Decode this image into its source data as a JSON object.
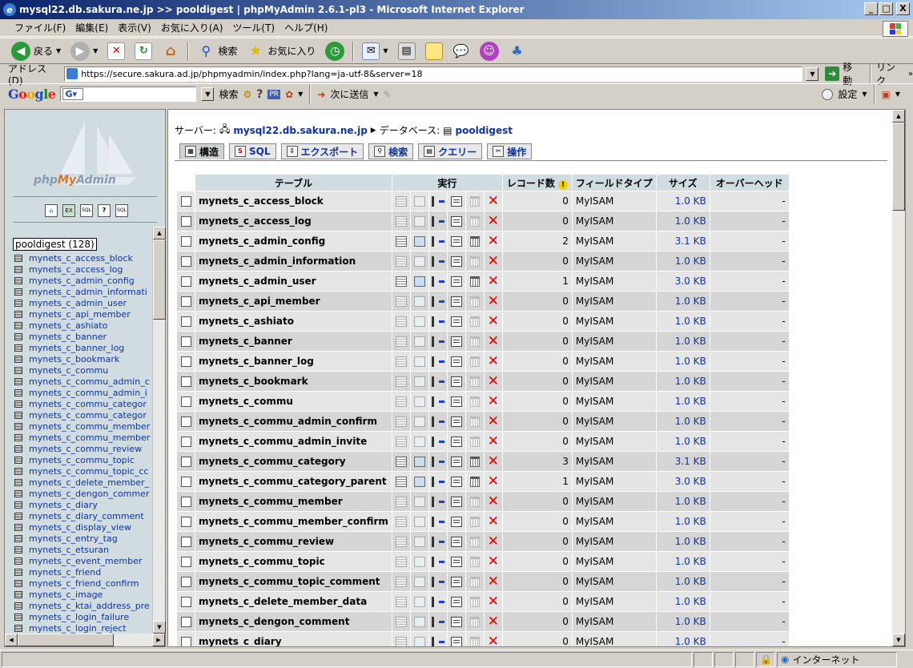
{
  "window": {
    "title": "mysql22.db.sakura.ne.jp >> pooldigest | phpMyAdmin 2.6.1-pl3 - Microsoft Internet Explorer",
    "btn_min": "_",
    "btn_max": "□",
    "btn_close": "X"
  },
  "menu": [
    "ファイル(F)",
    "編集(E)",
    "表示(V)",
    "お気に入り(A)",
    "ツール(T)",
    "ヘルプ(H)"
  ],
  "toolbar": {
    "back": "戻る",
    "search": "検索",
    "favorites": "お気に入り"
  },
  "address": {
    "label": "アドレス(D)",
    "url": "https://secure.sakura.ad.jp/phpmyadmin/index.php?lang=ja-utf-8&server=18",
    "go": "移動",
    "links": "リンク"
  },
  "google_bar": {
    "search": "検索",
    "send": "次に送信",
    "settings": "設定"
  },
  "left": {
    "logo_php": "php",
    "logo_my": "My",
    "logo_admin": "Admin",
    "db_name": "pooldigest",
    "db_count": "(128)",
    "tables": [
      "mynets_c_access_block",
      "mynets_c_access_log",
      "mynets_c_admin_config",
      "mynets_c_admin_informati",
      "mynets_c_admin_user",
      "mynets_c_api_member",
      "mynets_c_ashiato",
      "mynets_c_banner",
      "mynets_c_banner_log",
      "mynets_c_bookmark",
      "mynets_c_commu",
      "mynets_c_commu_admin_c",
      "mynets_c_commu_admin_i",
      "mynets_c_commu_categor",
      "mynets_c_commu_categor",
      "mynets_c_commu_member",
      "mynets_c_commu_member",
      "mynets_c_commu_review",
      "mynets_c_commu_topic",
      "mynets_c_commu_topic_cc",
      "mynets_c_delete_member_",
      "mynets_c_dengon_commer",
      "mynets_c_diary",
      "mynets_c_diary_comment",
      "mynets_c_display_view",
      "mynets_c_entry_tag",
      "mynets_c_etsuran",
      "mynets_c_event_member",
      "mynets_c_friend",
      "mynets_c_friend_confirm",
      "mynets_c_image",
      "mynets_c_ktai_address_pre",
      "mynets_c_login_failure",
      "mynets_c_login_reject"
    ]
  },
  "right": {
    "server_label": "サーバー:",
    "server": "mysql22.db.sakura.ne.jp",
    "db_label": "データベース:",
    "db": "pooldigest",
    "tabs": [
      "構造",
      "SQL",
      "エクスポート",
      "検索",
      "クエリー",
      "操作"
    ],
    "headers": {
      "table": "テーブル",
      "action": "実行",
      "records": "レコード数",
      "type": "フィールドタイプ",
      "size": "サイズ",
      "overhead": "オーバーヘッド"
    },
    "rows": [
      {
        "name": "mynets_c_access_block",
        "records": "0",
        "type": "MyISAM",
        "size": "1.0 KB",
        "overhead": "-",
        "has_data": false
      },
      {
        "name": "mynets_c_access_log",
        "records": "0",
        "type": "MyISAM",
        "size": "1.0 KB",
        "overhead": "-",
        "has_data": false
      },
      {
        "name": "mynets_c_admin_config",
        "records": "2",
        "type": "MyISAM",
        "size": "3.1 KB",
        "overhead": "-",
        "has_data": true
      },
      {
        "name": "mynets_c_admin_information",
        "records": "0",
        "type": "MyISAM",
        "size": "1.0 KB",
        "overhead": "-",
        "has_data": false
      },
      {
        "name": "mynets_c_admin_user",
        "records": "1",
        "type": "MyISAM",
        "size": "3.0 KB",
        "overhead": "-",
        "has_data": true
      },
      {
        "name": "mynets_c_api_member",
        "records": "0",
        "type": "MyISAM",
        "size": "1.0 KB",
        "overhead": "-",
        "has_data": false
      },
      {
        "name": "mynets_c_ashiato",
        "records": "0",
        "type": "MyISAM",
        "size": "1.0 KB",
        "overhead": "-",
        "has_data": false
      },
      {
        "name": "mynets_c_banner",
        "records": "0",
        "type": "MyISAM",
        "size": "1.0 KB",
        "overhead": "-",
        "has_data": false
      },
      {
        "name": "mynets_c_banner_log",
        "records": "0",
        "type": "MyISAM",
        "size": "1.0 KB",
        "overhead": "-",
        "has_data": false
      },
      {
        "name": "mynets_c_bookmark",
        "records": "0",
        "type": "MyISAM",
        "size": "1.0 KB",
        "overhead": "-",
        "has_data": false
      },
      {
        "name": "mynets_c_commu",
        "records": "0",
        "type": "MyISAM",
        "size": "1.0 KB",
        "overhead": "-",
        "has_data": false
      },
      {
        "name": "mynets_c_commu_admin_confirm",
        "records": "0",
        "type": "MyISAM",
        "size": "1.0 KB",
        "overhead": "-",
        "has_data": false
      },
      {
        "name": "mynets_c_commu_admin_invite",
        "records": "0",
        "type": "MyISAM",
        "size": "1.0 KB",
        "overhead": "-",
        "has_data": false
      },
      {
        "name": "mynets_c_commu_category",
        "records": "3",
        "type": "MyISAM",
        "size": "3.1 KB",
        "overhead": "-",
        "has_data": true
      },
      {
        "name": "mynets_c_commu_category_parent",
        "records": "1",
        "type": "MyISAM",
        "size": "3.0 KB",
        "overhead": "-",
        "has_data": true
      },
      {
        "name": "mynets_c_commu_member",
        "records": "0",
        "type": "MyISAM",
        "size": "1.0 KB",
        "overhead": "-",
        "has_data": false
      },
      {
        "name": "mynets_c_commu_member_confirm",
        "records": "0",
        "type": "MyISAM",
        "size": "1.0 KB",
        "overhead": "-",
        "has_data": false
      },
      {
        "name": "mynets_c_commu_review",
        "records": "0",
        "type": "MyISAM",
        "size": "1.0 KB",
        "overhead": "-",
        "has_data": false
      },
      {
        "name": "mynets_c_commu_topic",
        "records": "0",
        "type": "MyISAM",
        "size": "1.0 KB",
        "overhead": "-",
        "has_data": false
      },
      {
        "name": "mynets_c_commu_topic_comment",
        "records": "0",
        "type": "MyISAM",
        "size": "1.0 KB",
        "overhead": "-",
        "has_data": false
      },
      {
        "name": "mynets_c_delete_member_data",
        "records": "0",
        "type": "MyISAM",
        "size": "1.0 KB",
        "overhead": "-",
        "has_data": false
      },
      {
        "name": "mynets_c_dengon_comment",
        "records": "0",
        "type": "MyISAM",
        "size": "1.0 KB",
        "overhead": "-",
        "has_data": false
      },
      {
        "name": "mynets_c_diary",
        "records": "0",
        "type": "MyISAM",
        "size": "1.0 KB",
        "overhead": "-",
        "has_data": false
      }
    ]
  },
  "status": {
    "zone": "インターネット"
  }
}
